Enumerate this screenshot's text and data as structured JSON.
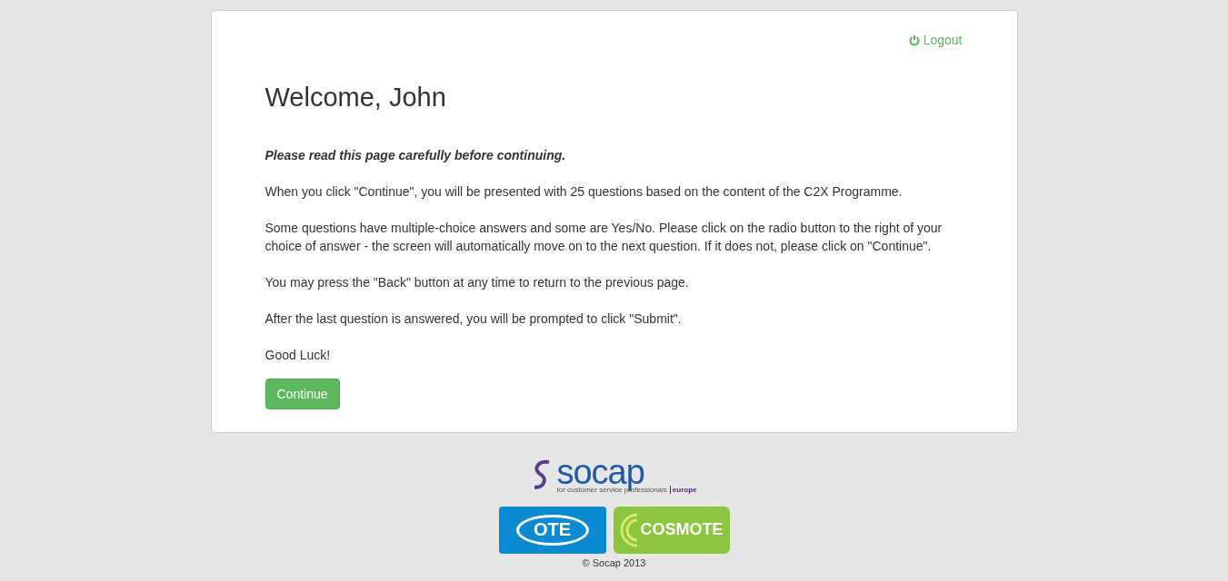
{
  "header": {
    "logout": "Logout"
  },
  "title": "Welcome, John",
  "intro": "Please read this page carefully before continuing.",
  "paragraphs": [
    "When you click \"Continue\", you will be presented with 25 questions based on the content of the C2X Programme.",
    "Some questions have multiple-choice answers and some are Yes/No. Please click on the radio button to the right of your choice of answer - the screen will automatically move on to the next question. If it does not, please click on \"Continue\".",
    "You may press the \"Back\" button at any time to return to the previous page.",
    "After the last question is answered, you will be prompted to click \"Submit\".",
    "Good Luck!"
  ],
  "continue_button": "Continue",
  "footer": {
    "logos": [
      {
        "kind": "socap",
        "name": "socap",
        "tagline": "for customer service professionals",
        "region": "europe"
      },
      {
        "kind": "ote",
        "name": "OTE"
      },
      {
        "kind": "cosmote",
        "name": "COSMOTE"
      }
    ],
    "copyright": "© Socap 2013"
  }
}
